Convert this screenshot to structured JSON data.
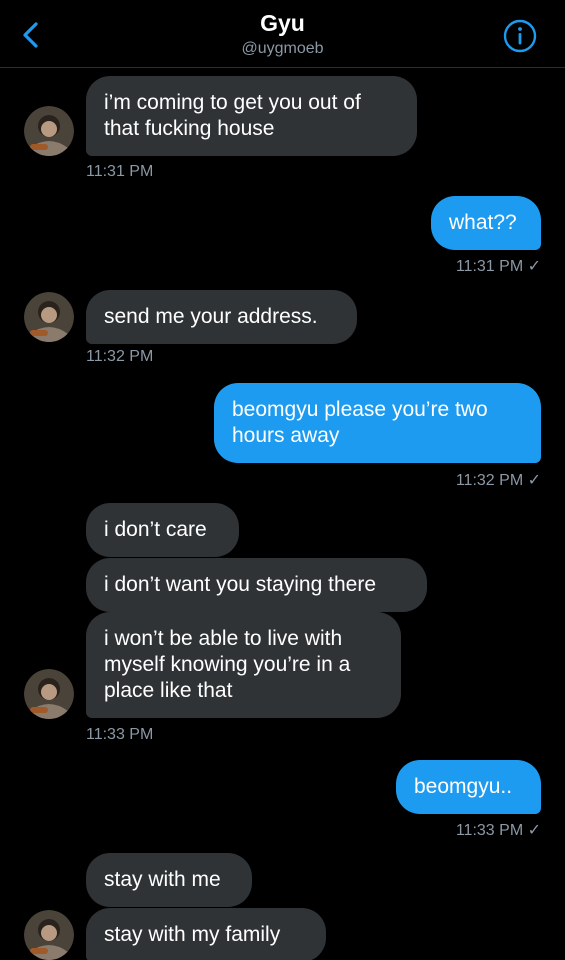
{
  "header": {
    "name": "Gyu",
    "handle": "@uygmoeb"
  },
  "messages": {
    "m1": "i’m coming to get you out of that fucking house",
    "t1": "11:31 PM",
    "m2": "what??",
    "t2": "11:31 PM ✓",
    "m3": "send me your address.",
    "t3": "11:32 PM",
    "m4": "beomgyu please you’re two hours away",
    "t4": "11:32 PM ✓",
    "m5": "i don’t care",
    "m6": "i don’t want you staying there",
    "m7": "i won’t be able to live with myself knowing you’re in a place like that",
    "t5": "11:33 PM",
    "m8": "beomgyu..",
    "t6": "11:33 PM ✓",
    "m9": "stay with me",
    "m10": "stay with my family"
  },
  "colors": {
    "accent": "#1d9bf0",
    "incoming_bubble": "#2f3336",
    "muted_text": "#8b98a5"
  },
  "icons": {
    "back": "chevron-left-icon",
    "info": "info-icon",
    "avatar": "avatar-photo"
  }
}
